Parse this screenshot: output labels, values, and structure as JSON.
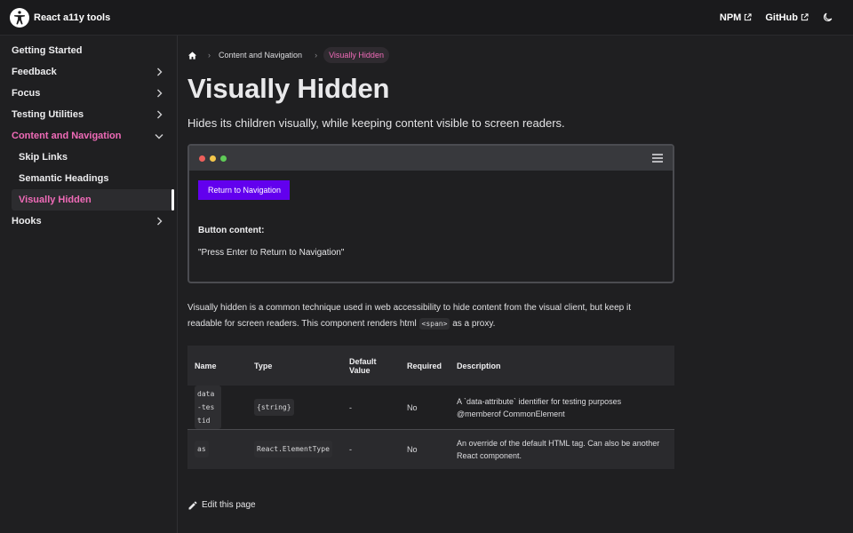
{
  "header": {
    "brand": "React a11y tools",
    "links": [
      {
        "label": "NPM"
      },
      {
        "label": "GitHub"
      }
    ]
  },
  "sidebar": {
    "items": [
      {
        "label": "Getting Started"
      },
      {
        "label": "Feedback"
      },
      {
        "label": "Focus"
      },
      {
        "label": "Testing Utilities"
      },
      {
        "label": "Content and Navigation"
      },
      {
        "label": "Skip Links"
      },
      {
        "label": "Semantic Headings"
      },
      {
        "label": "Visually Hidden"
      },
      {
        "label": "Hooks"
      }
    ]
  },
  "breadcrumb": {
    "section": "Content and Navigation",
    "current": "Visually Hidden"
  },
  "page": {
    "title": "Visually Hidden",
    "lede": "Hides its children visually, while keeping content visible to screen readers."
  },
  "demo": {
    "button_label": "Return to Navigation",
    "content_label": "Button content:",
    "content_value": "\"Press Enter to Return to Navigation\"",
    "dot_colors": [
      "#ee5f5b",
      "#f3c64b",
      "#5fcb57"
    ]
  },
  "description": {
    "text_before": "Visually hidden is a common technique used in web accessibility to hide content from the visual client, but keep it readable for screen readers. This component renders html ",
    "code": "<span>",
    "text_after": " as a proxy."
  },
  "props_table": {
    "headers": {
      "name": "Name",
      "type": "Type",
      "default": "Default Value",
      "required": "Required",
      "description": "Description"
    },
    "rows": [
      {
        "name": "data-testid",
        "type": "{string}",
        "default": "-",
        "required": "No",
        "description": "A `data-attribute` identifier for testing purposes @memberof CommonElement"
      },
      {
        "name": "as",
        "type": "React.ElementType",
        "default": "-",
        "required": "No",
        "description": "An override of the default HTML tag. Can also be another React component."
      }
    ]
  },
  "footer": {
    "edit_label": "Edit this page"
  },
  "colors": {
    "accent": "#f06bb8",
    "button": "#6200ee",
    "background": "#1f1f21"
  }
}
